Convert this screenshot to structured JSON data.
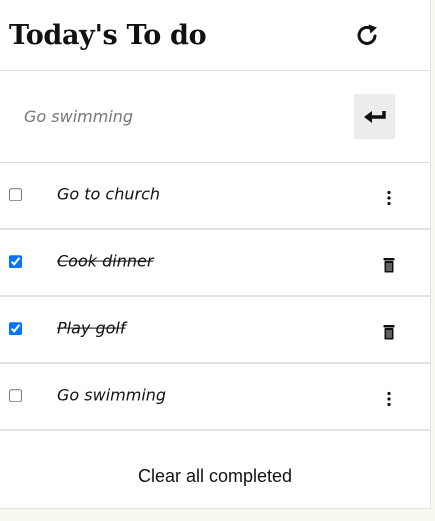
{
  "header": {
    "title": "Today's To do",
    "refresh_icon": "refresh-icon"
  },
  "add": {
    "placeholder": "Go swimming",
    "submit_icon": "enter-icon"
  },
  "todos": [
    {
      "label": "Go to church",
      "completed": false,
      "action_icon": "kebab-menu-icon"
    },
    {
      "label": "Cook dinner",
      "completed": true,
      "action_icon": "trash-icon"
    },
    {
      "label": "Play golf",
      "completed": true,
      "action_icon": "trash-icon"
    },
    {
      "label": "Go swimming",
      "completed": false,
      "action_icon": "kebab-menu-icon"
    }
  ],
  "footer": {
    "clear_label": "Clear all completed"
  },
  "colors": {
    "checkbox_accent": "#0075ff",
    "enter_button_bg": "#ececec"
  }
}
